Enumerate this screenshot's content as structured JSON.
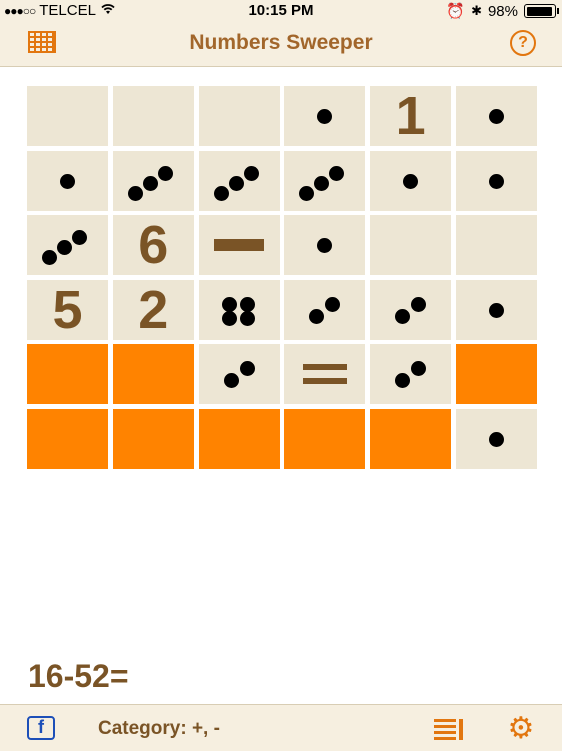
{
  "status_bar": {
    "carrier": "TELCEL",
    "time": "10:15 PM",
    "battery": "98%"
  },
  "navbar": {
    "title": "Numbers Sweeper",
    "left_icon": "grid-icon",
    "right_icon": "help-icon",
    "help_glyph": "?"
  },
  "board": {
    "rows": [
      [
        {
          "t": "empty"
        },
        {
          "t": "empty"
        },
        {
          "t": "empty"
        },
        {
          "t": "dice",
          "n": 1
        },
        {
          "t": "num",
          "v": "1"
        },
        {
          "t": "dice",
          "n": 1
        }
      ],
      [
        {
          "t": "dice",
          "n": 1
        },
        {
          "t": "dice",
          "n": 3
        },
        {
          "t": "dice",
          "n": 3
        },
        {
          "t": "dice",
          "n": 3
        },
        {
          "t": "dice",
          "n": 1
        },
        {
          "t": "dice",
          "n": 1
        }
      ],
      [
        {
          "t": "dice",
          "n": 3
        },
        {
          "t": "num",
          "v": "6"
        },
        {
          "t": "op",
          "v": "minus"
        },
        {
          "t": "dice",
          "n": 1
        },
        {
          "t": "empty"
        },
        {
          "t": "empty"
        }
      ],
      [
        {
          "t": "num",
          "v": "5"
        },
        {
          "t": "num",
          "v": "2"
        },
        {
          "t": "dice",
          "n": 4
        },
        {
          "t": "dice",
          "n": 2
        },
        {
          "t": "dice",
          "n": 2
        },
        {
          "t": "dice",
          "n": 1
        }
      ],
      [
        {
          "t": "hidden"
        },
        {
          "t": "hidden"
        },
        {
          "t": "dice",
          "n": 2
        },
        {
          "t": "op",
          "v": "equals"
        },
        {
          "t": "dice",
          "n": 2
        },
        {
          "t": "hidden"
        }
      ],
      [
        {
          "t": "hidden"
        },
        {
          "t": "hidden"
        },
        {
          "t": "hidden"
        },
        {
          "t": "hidden"
        },
        {
          "t": "hidden"
        },
        {
          "t": "dice",
          "n": 1
        }
      ]
    ],
    "colors": {
      "tile": "#ede6d4",
      "hidden": "#ff8300",
      "digit": "#7a5426"
    }
  },
  "expression": "16-52=",
  "bottom_bar": {
    "facebook_glyph": "f",
    "category": "Category: +, -",
    "list_icon": "list-icon",
    "settings_icon": "gear-icon"
  }
}
